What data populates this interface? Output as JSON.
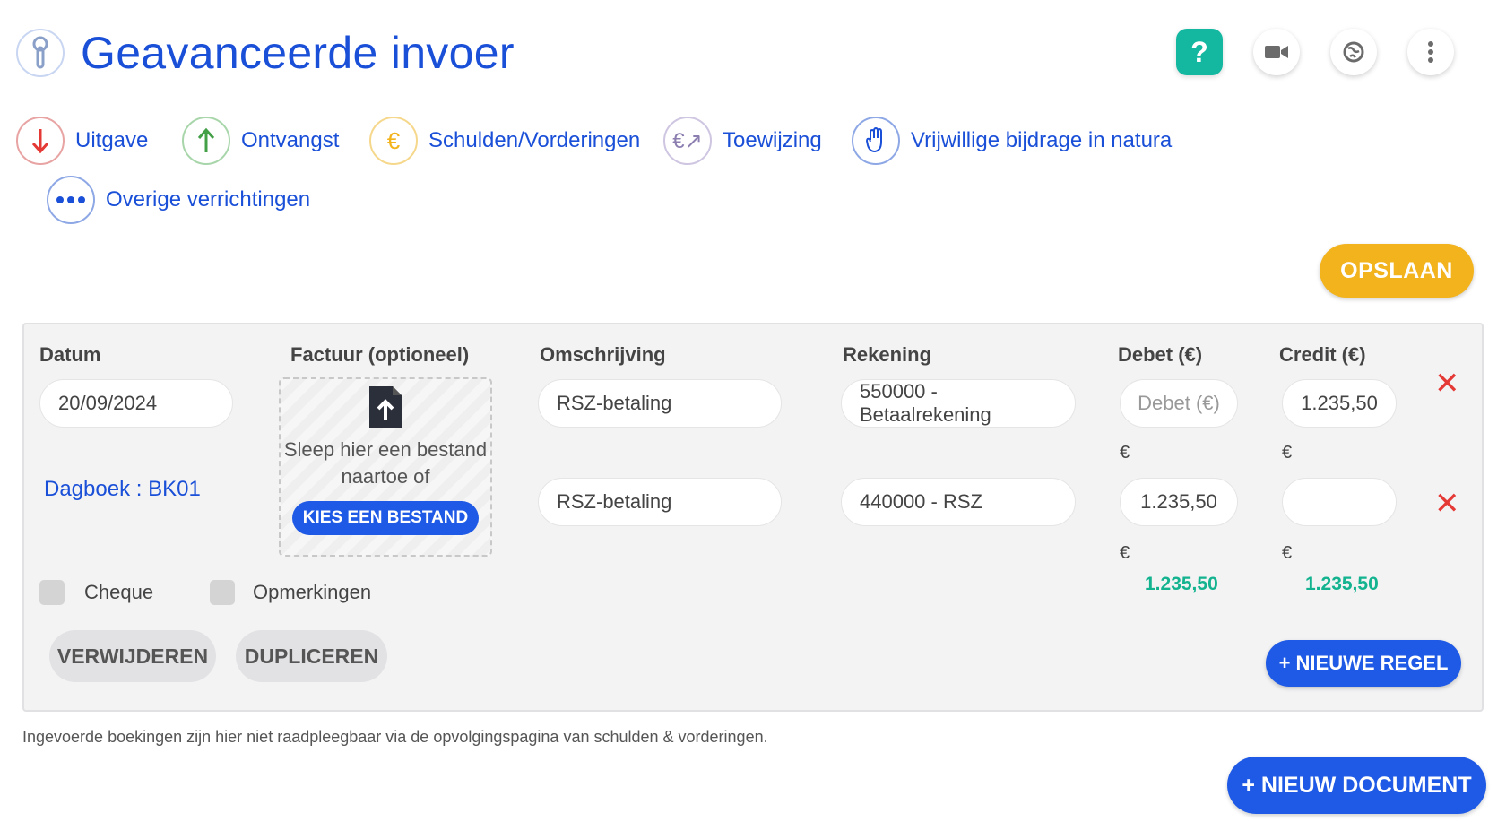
{
  "header": {
    "title": "Geavanceerde invoer",
    "title_icon": "wrench-icon",
    "help_label": "?",
    "icons": [
      "video-icon",
      "globe-icon",
      "more-vertical-icon"
    ]
  },
  "types": [
    {
      "label": "Uitgave",
      "icon": "arrow-down-icon",
      "color": "#e53935"
    },
    {
      "label": "Ontvangst",
      "icon": "arrow-up-icon",
      "color": "#43a047"
    },
    {
      "label": "Schulden/Vorderingen",
      "icon": "euro-icon",
      "color": "#f2b31d"
    },
    {
      "label": "Toewijzing",
      "icon": "euro-exchange-icon",
      "color": "#9e8cc0"
    },
    {
      "label": "Vrijwillige bijdrage in natura",
      "icon": "hand-icon",
      "color": "#1a4fd8"
    },
    {
      "label": "Overige verrichtingen",
      "icon": "more-horizontal-icon",
      "color": "#1a4fd8"
    }
  ],
  "toolbar": {
    "save_label": "OPSLAAN"
  },
  "form": {
    "headers": {
      "datum": "Datum",
      "factuur": "Factuur (optioneel)",
      "omschrijving": "Omschrijving",
      "rekening": "Rekening",
      "debet": "Debet (€)",
      "credit": "Credit (€)"
    },
    "date_value": "20/09/2024",
    "journal": "Dagboek : BK01",
    "upload": {
      "text": "Sleep hier een bestand naartoe of",
      "button": "KIES EEN BESTAND"
    },
    "rows": [
      {
        "omschrijving": "RSZ-betaling",
        "rekening": "550000 - Betaalrekening",
        "debet": "",
        "debet_placeholder": "Debet (€)",
        "credit": "1.235,50"
      },
      {
        "omschrijving": "RSZ-betaling",
        "rekening": "440000 - RSZ",
        "debet": "1.235,50",
        "credit": ""
      }
    ],
    "currency_symbol": "€",
    "totals": {
      "debet": "1.235,50",
      "credit": "1.235,50"
    },
    "checkboxes": {
      "cheque": "Cheque",
      "opmerkingen": "Opmerkingen"
    },
    "buttons": {
      "delete": "VERWIJDEREN",
      "duplicate": "DUPLICEREN",
      "new_line": "+ NIEUWE REGEL"
    }
  },
  "note": "Ingevoerde boekingen zijn hier niet raadpleegbaar via de opvolgingspagina van schulden & vorderingen.",
  "new_document_label": "+ NIEUW DOCUMENT",
  "colors": {
    "accent": "#1a4fd8",
    "save": "#f2b31d",
    "total": "#14b38f",
    "danger": "#e53935"
  }
}
